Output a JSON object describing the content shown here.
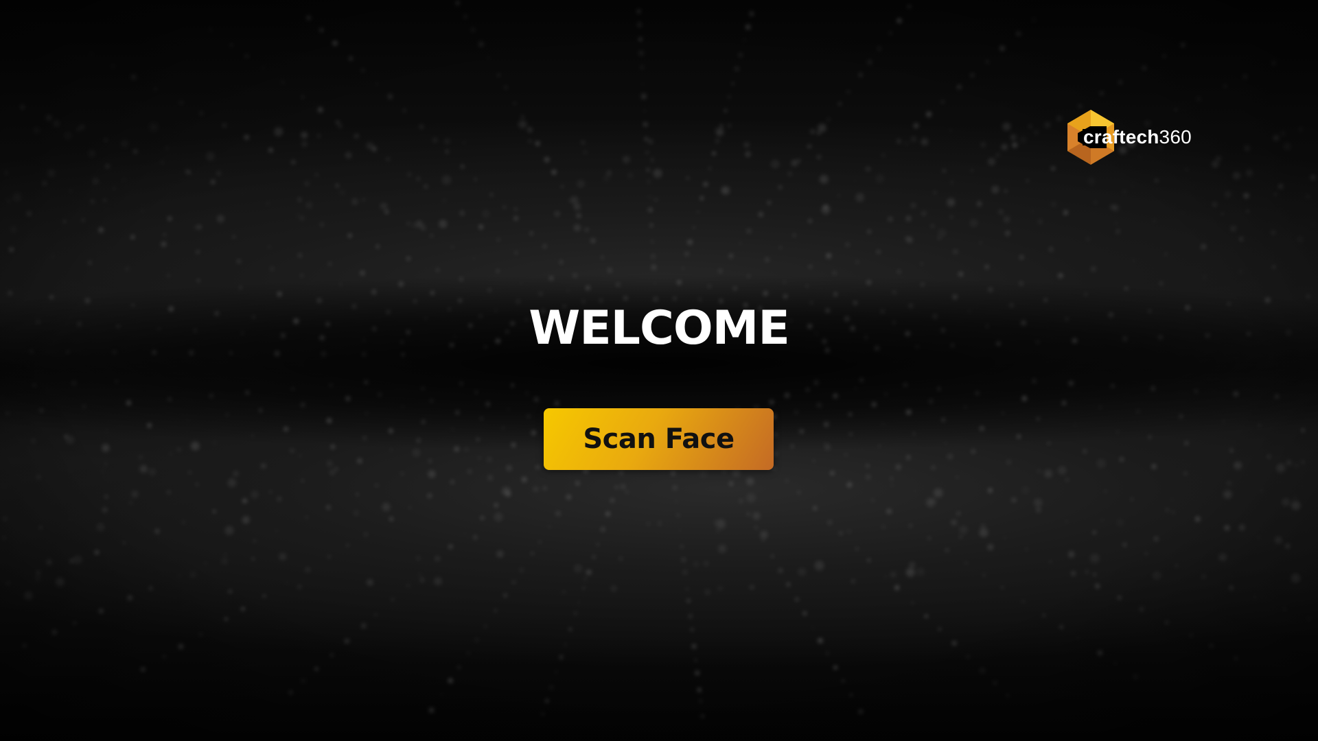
{
  "logo": {
    "brand_bold": "craftech",
    "brand_light": "360",
    "mark_icon": "hexagon-c-logo-icon",
    "colors": {
      "gold": "#f2b21b",
      "orange": "#d9822b",
      "dark": "#8a4a1e"
    }
  },
  "main": {
    "title": "WELCOME",
    "scan_button_label": "Scan Face"
  },
  "theme": {
    "background": "#000000",
    "button_gradient_start": "#f6c800",
    "button_gradient_end": "#c46a25",
    "title_color": "#ffffff"
  }
}
